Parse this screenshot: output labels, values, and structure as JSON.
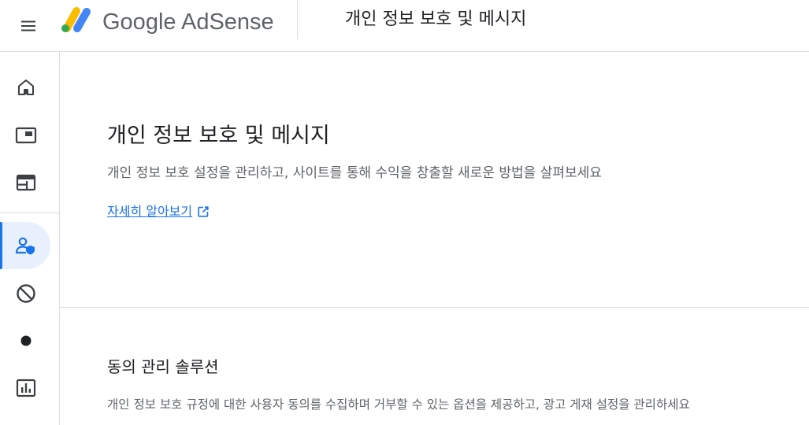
{
  "header": {
    "brand": "Google AdSense",
    "title": "개인 정보 보호 및 메시지",
    "menu_icon": "menu-icon",
    "logo_colors": {
      "yellow": "#FBBC04",
      "green": "#34A853",
      "blue": "#4285F4"
    }
  },
  "rail": {
    "items": [
      {
        "icon": "home-icon",
        "active": false
      },
      {
        "icon": "ads-icon",
        "active": false
      },
      {
        "icon": "sites-icon",
        "active": false
      },
      {
        "icon": "privacy-messaging-icon",
        "active": true
      },
      {
        "icon": "block-icon",
        "active": false
      },
      {
        "icon": "dot-icon",
        "active": false
      },
      {
        "icon": "reports-icon",
        "active": false
      }
    ]
  },
  "main": {
    "title": "개인 정보 보호 및 메시지",
    "description": "개인 정보 보호 설정을 관리하고, 사이트를 통해 수익을 창출할 새로운 방법을 살펴보세요",
    "learn_more": "자세히 알아보기",
    "learn_more_icon": "open-in-new-icon",
    "section2": {
      "title": "동의 관리 솔루션",
      "description": "개인 정보 보호 규정에 대한 사용자 동의를 수집하며 거부할 수 있는 옵션을 제공하고, 광고 게재 설정을 관리하세요"
    }
  },
  "colors": {
    "accent": "#1a73e8",
    "active_bg": "#e8f0fe",
    "divider": "#dadce0",
    "text_primary": "#202124",
    "text_secondary": "#5f6368"
  }
}
